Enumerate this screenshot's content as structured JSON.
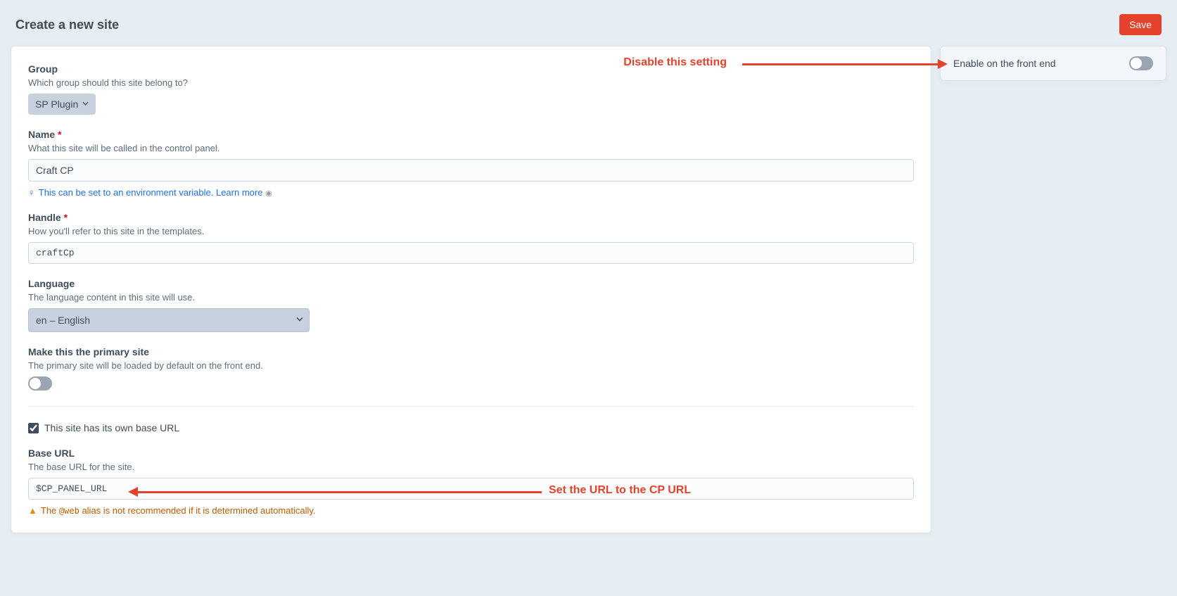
{
  "page_title": "Create a new site",
  "save_label": "Save",
  "sidebar": {
    "enable_label": "Enable on the front end",
    "enable_value": false
  },
  "group": {
    "label": "Group",
    "instructions": "Which group should this site belong to?",
    "selected": "SP Plugin"
  },
  "name": {
    "label": "Name",
    "instructions": "What this site will be called in the control panel.",
    "value": "Craft CP",
    "tip_text": "This can be set to an environment variable.",
    "tip_link": "Learn more"
  },
  "handle": {
    "label": "Handle",
    "instructions": "How you'll refer to this site in the templates.",
    "value": "craftCp"
  },
  "language": {
    "label": "Language",
    "instructions": "The language content in this site will use.",
    "selected": "en – English"
  },
  "primary": {
    "label": "Make this the primary site",
    "instructions": "The primary site will be loaded by default on the front end.",
    "value": false
  },
  "has_url": {
    "label": "This site has its own base URL",
    "value": true
  },
  "base_url": {
    "label": "Base URL",
    "instructions": "The base URL for the site.",
    "value": "$CP_PANEL_URL",
    "warning_prefix": "The",
    "warning_code": "@web",
    "warning_suffix": "alias is not recommended if it is determined automatically."
  },
  "annotations": {
    "disable": "Disable this setting",
    "set_url": "Set the URL to the CP URL"
  }
}
